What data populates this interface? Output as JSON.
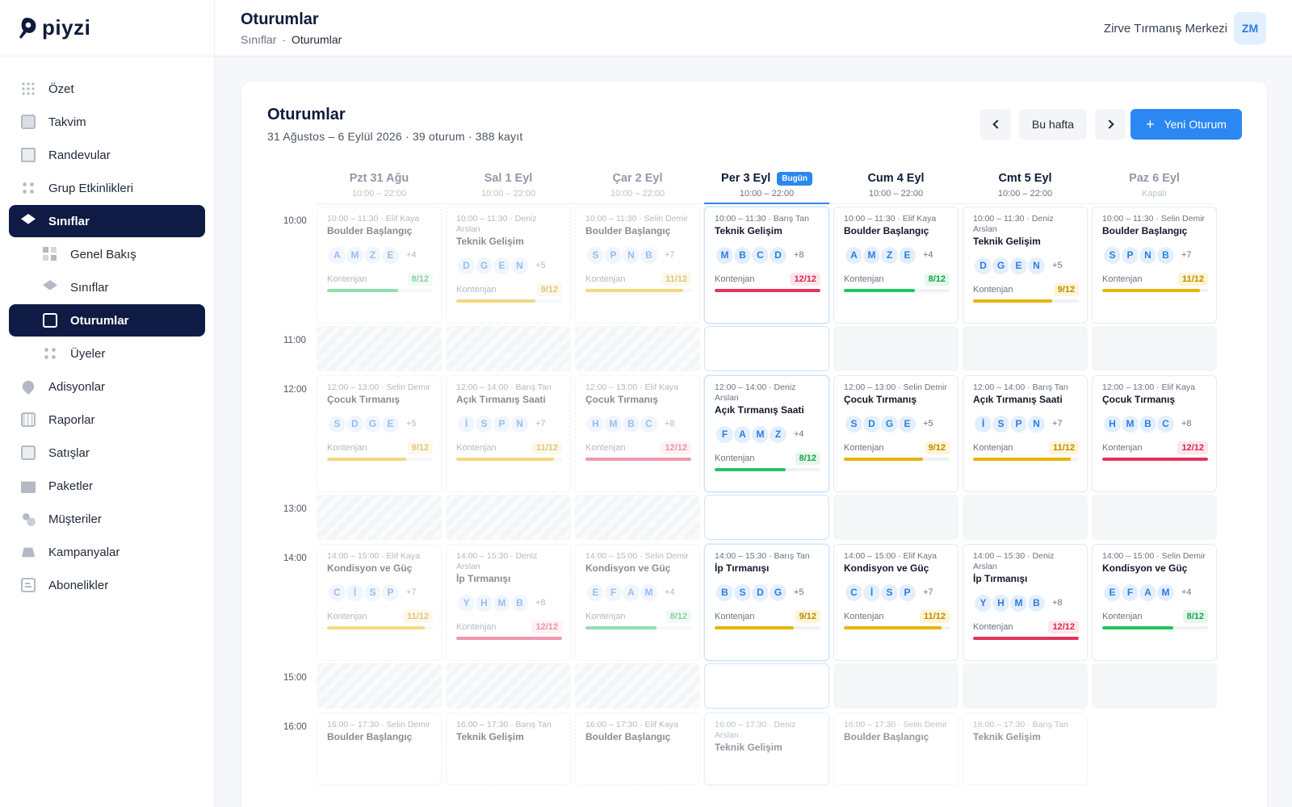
{
  "brand": {
    "name": "piyzi"
  },
  "sidebar": {
    "items": [
      {
        "label": "Özet",
        "icon": "grid-icon",
        "cls": "i-grid",
        "level": "top",
        "state": ""
      },
      {
        "label": "Takvim",
        "icon": "calendar-icon",
        "cls": "i-box",
        "level": "top",
        "state": ""
      },
      {
        "label": "Randevular",
        "icon": "document-icon",
        "cls": "i-doc",
        "level": "top",
        "state": ""
      },
      {
        "label": "Grup Etkinlikleri",
        "icon": "group-icon",
        "cls": "i-dots",
        "level": "top",
        "state": ""
      },
      {
        "label": "Sınıflar",
        "icon": "graduation-cap-icon",
        "cls": "i-cap-w",
        "level": "top",
        "state": "active"
      },
      {
        "label": "Genel Bakış",
        "icon": "overview-icon",
        "cls": "i-sq",
        "level": "sub",
        "state": ""
      },
      {
        "label": "Sınıflar",
        "icon": "graduation-cap-icon",
        "cls": "i-cap",
        "level": "sub",
        "state": ""
      },
      {
        "label": "Oturumlar",
        "icon": "calendar-icon",
        "cls": "i-cal-w",
        "level": "sub",
        "state": "active"
      },
      {
        "label": "Üyeler",
        "icon": "members-icon",
        "cls": "i-dots",
        "level": "sub",
        "state": ""
      },
      {
        "label": "Adisyonlar",
        "icon": "location-pin-icon",
        "cls": "i-pin",
        "level": "top",
        "state": ""
      },
      {
        "label": "Raporlar",
        "icon": "calculator-icon",
        "cls": "i-calc",
        "level": "top",
        "state": ""
      },
      {
        "label": "Satışlar",
        "icon": "money-icon",
        "cls": "i-money",
        "level": "top",
        "state": ""
      },
      {
        "label": "Paketler",
        "icon": "package-icon",
        "cls": "i-pack",
        "level": "top",
        "state": ""
      },
      {
        "label": "Müşteriler",
        "icon": "users-icon",
        "cls": "i-users",
        "level": "top",
        "state": ""
      },
      {
        "label": "Kampanyalar",
        "icon": "bell-icon",
        "cls": "i-bell",
        "level": "top",
        "state": ""
      },
      {
        "label": "Abonelikler",
        "icon": "id-card-icon",
        "cls": "i-card",
        "level": "top",
        "state": ""
      }
    ]
  },
  "header": {
    "title": "Oturumlar",
    "breadcrumb": {
      "parent": "Sınıflar",
      "separator": "-",
      "current": "Oturumlar"
    },
    "org_name": "Zirve Tırmanış Merkezi",
    "avatar_initials": "ZM"
  },
  "panel": {
    "title": "Oturumlar",
    "subtitle": "31 Ağustos – 6 Eylül 2026 · 39 oturum · 388 kayıt",
    "this_week_label": "Bu hafta",
    "new_session_label": "Yeni Oturum",
    "today_badge": "Bugün"
  },
  "colors": {
    "accent": "#2b87f2",
    "nav_active": "#0f1b44",
    "ok": "#22c55e",
    "warn": "#eab308",
    "full": "#e2335d"
  },
  "days": [
    {
      "name": "Pzt 31 Ağu",
      "hours": "10:00 – 22:00",
      "state": "past"
    },
    {
      "name": "Sal 1 Eyl",
      "hours": "10:00 – 22:00",
      "state": "past"
    },
    {
      "name": "Çar 2 Eyl",
      "hours": "10:00 – 22:00",
      "state": "past"
    },
    {
      "name": "Per 3 Eyl",
      "hours": "10:00 – 22:00",
      "state": "today"
    },
    {
      "name": "Cum 4 Eyl",
      "hours": "10:00 – 22:00",
      "state": "future"
    },
    {
      "name": "Cmt 5 Eyl",
      "hours": "10:00 – 22:00",
      "state": "future"
    },
    {
      "name": "Paz 6 Eyl",
      "hours": "Kapalı",
      "state": "closed"
    }
  ],
  "time_labels": [
    "10:00",
    "11:00",
    "12:00",
    "13:00",
    "14:00",
    "15:00",
    "16:00"
  ],
  "capacity_label": "Kontenjan",
  "sessions": [
    {
      "day": 0,
      "row": 0,
      "time": "10:00 – 11:30 · Elif Kaya",
      "name": "Boulder Başlangıç",
      "avatars": [
        "A",
        "M",
        "Z",
        "E"
      ],
      "more": "+4",
      "booked": 8,
      "capacity": 12
    },
    {
      "day": 1,
      "row": 0,
      "time": "10:00 – 11:30 · Deniz Arslan",
      "name": "Teknik Gelişim",
      "avatars": [
        "D",
        "G",
        "E",
        "N"
      ],
      "more": "+5",
      "booked": 9,
      "capacity": 12
    },
    {
      "day": 2,
      "row": 0,
      "time": "10:00 – 11:30 · Selin Demir",
      "name": "Boulder Başlangıç",
      "avatars": [
        "S",
        "P",
        "N",
        "B"
      ],
      "more": "+7",
      "booked": 11,
      "capacity": 12
    },
    {
      "day": 3,
      "row": 0,
      "time": "10:00 – 11:30 · Barış Tan",
      "name": "Teknik Gelişim",
      "avatars": [
        "M",
        "B",
        "C",
        "D"
      ],
      "more": "+8",
      "booked": 12,
      "capacity": 12
    },
    {
      "day": 4,
      "row": 0,
      "time": "10:00 – 11:30 · Elif Kaya",
      "name": "Boulder Başlangıç",
      "avatars": [
        "A",
        "M",
        "Z",
        "E"
      ],
      "more": "+4",
      "booked": 8,
      "capacity": 12
    },
    {
      "day": 5,
      "row": 0,
      "time": "10:00 – 11:30 · Deniz Arslan",
      "name": "Teknik Gelişim",
      "avatars": [
        "D",
        "G",
        "E",
        "N"
      ],
      "more": "+5",
      "booked": 9,
      "capacity": 12
    },
    {
      "day": 6,
      "row": 0,
      "time": "10:00 – 11:30 · Selin Demir",
      "name": "Boulder Başlangıç",
      "avatars": [
        "S",
        "P",
        "N",
        "B"
      ],
      "more": "+7",
      "booked": 11,
      "capacity": 12
    },
    {
      "day": 0,
      "row": 2,
      "time": "12:00 – 13:00 · Selin Demir",
      "name": "Çocuk Tırmanış",
      "avatars": [
        "S",
        "D",
        "G",
        "E"
      ],
      "more": "+5",
      "booked": 9,
      "capacity": 12
    },
    {
      "day": 1,
      "row": 2,
      "time": "12:00 – 14:00 · Barış Tan",
      "name": "Açık Tırmanış Saati",
      "avatars": [
        "İ",
        "S",
        "P",
        "N"
      ],
      "more": "+7",
      "booked": 11,
      "capacity": 12
    },
    {
      "day": 2,
      "row": 2,
      "time": "12:00 – 13:00 · Elif Kaya",
      "name": "Çocuk Tırmanış",
      "avatars": [
        "H",
        "M",
        "B",
        "C"
      ],
      "more": "+8",
      "booked": 12,
      "capacity": 12
    },
    {
      "day": 3,
      "row": 2,
      "time": "12:00 – 14:00 · Deniz Arslan",
      "name": "Açık Tırmanış Saati",
      "avatars": [
        "F",
        "A",
        "M",
        "Z"
      ],
      "more": "+4",
      "booked": 8,
      "capacity": 12
    },
    {
      "day": 4,
      "row": 2,
      "time": "12:00 – 13:00 · Selin Demir",
      "name": "Çocuk Tırmanış",
      "avatars": [
        "S",
        "D",
        "G",
        "E"
      ],
      "more": "+5",
      "booked": 9,
      "capacity": 12
    },
    {
      "day": 5,
      "row": 2,
      "time": "12:00 – 14:00 · Barış Tan",
      "name": "Açık Tırmanış Saati",
      "avatars": [
        "İ",
        "S",
        "P",
        "N"
      ],
      "more": "+7",
      "booked": 11,
      "capacity": 12
    },
    {
      "day": 6,
      "row": 2,
      "time": "12:00 – 13:00 · Elif Kaya",
      "name": "Çocuk Tırmanış",
      "avatars": [
        "H",
        "M",
        "B",
        "C"
      ],
      "more": "+8",
      "booked": 12,
      "capacity": 12
    },
    {
      "day": 0,
      "row": 4,
      "time": "14:00 – 15:00 · Elif Kaya",
      "name": "Kondisyon ve Güç",
      "avatars": [
        "C",
        "İ",
        "S",
        "P"
      ],
      "more": "+7",
      "booked": 11,
      "capacity": 12
    },
    {
      "day": 1,
      "row": 4,
      "time": "14:00 – 15:30 · Deniz Arslan",
      "name": "İp Tırmanışı",
      "avatars": [
        "Y",
        "H",
        "M",
        "B"
      ],
      "more": "+8",
      "booked": 12,
      "capacity": 12
    },
    {
      "day": 2,
      "row": 4,
      "time": "14:00 – 15:00 · Selin Demir",
      "name": "Kondisyon ve Güç",
      "avatars": [
        "E",
        "F",
        "A",
        "M"
      ],
      "more": "+4",
      "booked": 8,
      "capacity": 12
    },
    {
      "day": 3,
      "row": 4,
      "time": "14:00 – 15:30 · Barış Tan",
      "name": "İp Tırmanışı",
      "avatars": [
        "B",
        "S",
        "D",
        "G"
      ],
      "more": "+5",
      "booked": 9,
      "capacity": 12
    },
    {
      "day": 4,
      "row": 4,
      "time": "14:00 – 15:00 · Elif Kaya",
      "name": "Kondisyon ve Güç",
      "avatars": [
        "C",
        "İ",
        "S",
        "P"
      ],
      "more": "+7",
      "booked": 11,
      "capacity": 12
    },
    {
      "day": 5,
      "row": 4,
      "time": "14:00 – 15:30 · Deniz Arslan",
      "name": "İp Tırmanışı",
      "avatars": [
        "Y",
        "H",
        "M",
        "B"
      ],
      "more": "+8",
      "booked": 12,
      "capacity": 12
    },
    {
      "day": 6,
      "row": 4,
      "time": "14:00 – 15:00 · Selin Demir",
      "name": "Kondisyon ve Güç",
      "avatars": [
        "E",
        "F",
        "A",
        "M"
      ],
      "more": "+4",
      "booked": 8,
      "capacity": 12
    },
    {
      "day": 0,
      "row": 6,
      "time": "16:00 – 17:30 · Selin Demir",
      "name": "Boulder Başlangıç",
      "avatars": [],
      "more": "",
      "booked": null,
      "capacity": null
    },
    {
      "day": 1,
      "row": 6,
      "time": "16:00 – 17:30 · Barış Tan",
      "name": "Teknik Gelişim",
      "avatars": [],
      "more": "",
      "booked": null,
      "capacity": null
    },
    {
      "day": 2,
      "row": 6,
      "time": "16:00 – 17:30 · Elif Kaya",
      "name": "Boulder Başlangıç",
      "avatars": [],
      "more": "",
      "booked": null,
      "capacity": null
    },
    {
      "day": 3,
      "row": 6,
      "time": "16:00 – 17:30 · Deniz Arslan",
      "name": "Teknik Gelişim",
      "avatars": [],
      "more": "",
      "booked": null,
      "capacity": null
    },
    {
      "day": 4,
      "row": 6,
      "time": "16:00 – 17:30 · Selin Demir",
      "name": "Boulder Başlangıç",
      "avatars": [],
      "more": "",
      "booked": null,
      "capacity": null
    },
    {
      "day": 5,
      "row": 6,
      "time": "16:00 – 17:30 · Barış Tan",
      "name": "Teknik Gelişim",
      "avatars": [],
      "more": "",
      "booked": null,
      "capacity": null
    }
  ]
}
